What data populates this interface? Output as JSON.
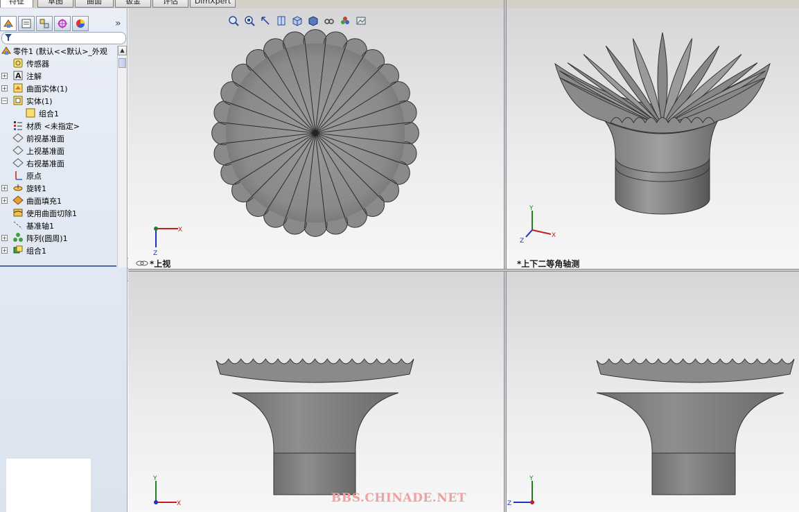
{
  "tabs": [
    {
      "label": "特征",
      "active": true
    },
    {
      "label": "草图",
      "active": false
    },
    {
      "label": "曲面",
      "active": false
    },
    {
      "label": "钣金",
      "active": false
    },
    {
      "label": "评估",
      "active": false
    },
    {
      "label": "DimXpert",
      "active": false
    }
  ],
  "panel_tabs": [
    "feature-manager-icon",
    "property-manager-icon",
    "configuration-manager-icon",
    "dimxpert-manager-icon",
    "display-manager-icon"
  ],
  "tree": [
    {
      "label": "零件1    (默认<<默认>_外观",
      "icon": "part-icon",
      "expandable": false
    },
    {
      "label": "传感器",
      "icon": "sensor-icon",
      "expandable": false
    },
    {
      "label": "注解",
      "icon": "annotation-icon",
      "expandable": true
    },
    {
      "label": "曲面实体(1)",
      "icon": "surface-body-icon",
      "expandable": true
    },
    {
      "label": "实体(1)",
      "icon": "solid-body-icon",
      "expandable": true,
      "expanded": true
    },
    {
      "label": "组合1",
      "icon": "combine-body-icon",
      "expandable": false
    },
    {
      "label": "材质 <未指定>",
      "icon": "material-icon",
      "expandable": false
    },
    {
      "label": "前视基准面",
      "icon": "plane-icon",
      "expandable": false
    },
    {
      "label": "上视基准面",
      "icon": "plane-icon",
      "expandable": false
    },
    {
      "label": "右视基准面",
      "icon": "plane-icon",
      "expandable": false
    },
    {
      "label": "原点",
      "icon": "origin-icon",
      "expandable": false
    },
    {
      "label": "旋转1",
      "icon": "revolve-icon",
      "expandable": true
    },
    {
      "label": "曲面填充1",
      "icon": "surface-fill-icon",
      "expandable": true
    },
    {
      "label": "使用曲面切除1",
      "icon": "surface-cut-icon",
      "expandable": false
    },
    {
      "label": "基准轴1",
      "icon": "axis-icon",
      "expandable": false
    },
    {
      "label": "阵列(圆周)1",
      "icon": "circular-pattern-icon",
      "expandable": true
    },
    {
      "label": "组合1",
      "icon": "combine-icon",
      "expandable": true
    }
  ],
  "views": {
    "top_label": "*上视",
    "iso_label": "*上下二等角轴测"
  },
  "axes": {
    "x": "X",
    "y": "Y",
    "z": "Z"
  },
  "heads_up_toolbar": [
    "zoom-to-fit-icon",
    "zoom-area-icon",
    "previous-view-icon",
    "section-view-icon",
    "view-orientation-icon",
    "display-style-icon",
    "hide-show-icon",
    "edit-appearance-icon",
    "apply-scene-icon"
  ],
  "watermark": "BBS.CHINADE.NET",
  "colors": {
    "model_gray": "#8a8a8a",
    "model_dark": "#4a4a4a",
    "accent_blue": "#2a4a9a"
  }
}
